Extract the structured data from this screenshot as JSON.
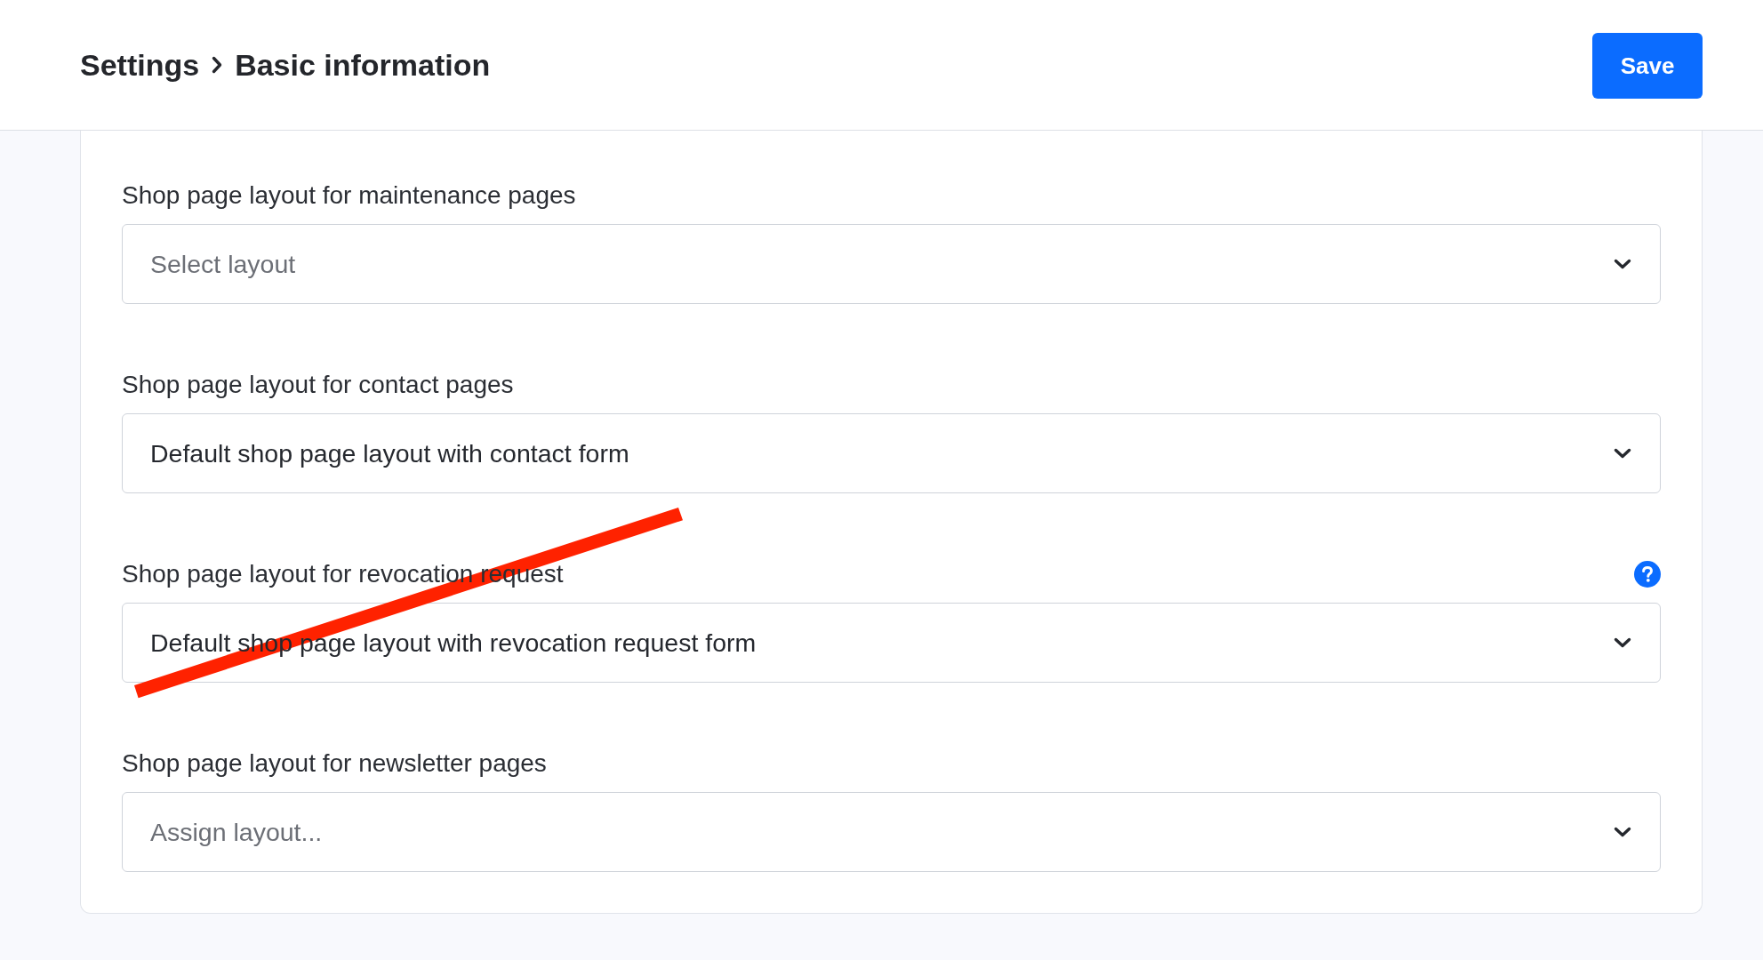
{
  "header": {
    "breadcrumb": [
      "Settings",
      "Basic information"
    ],
    "save_button": "Save"
  },
  "fields": [
    {
      "label": "Shop page layout for maintenance pages",
      "placeholder": "Select layout",
      "help": false
    },
    {
      "label": "Shop page layout for contact pages",
      "value": "Default shop page layout with contact form",
      "help": false
    },
    {
      "label": "Shop page layout for revocation request",
      "value": "Default shop page layout with revocation request form",
      "help": true
    },
    {
      "label": "Shop page layout for newsletter pages",
      "placeholder": "Assign layout...",
      "help": false
    }
  ],
  "annotation": {
    "kind": "line"
  }
}
